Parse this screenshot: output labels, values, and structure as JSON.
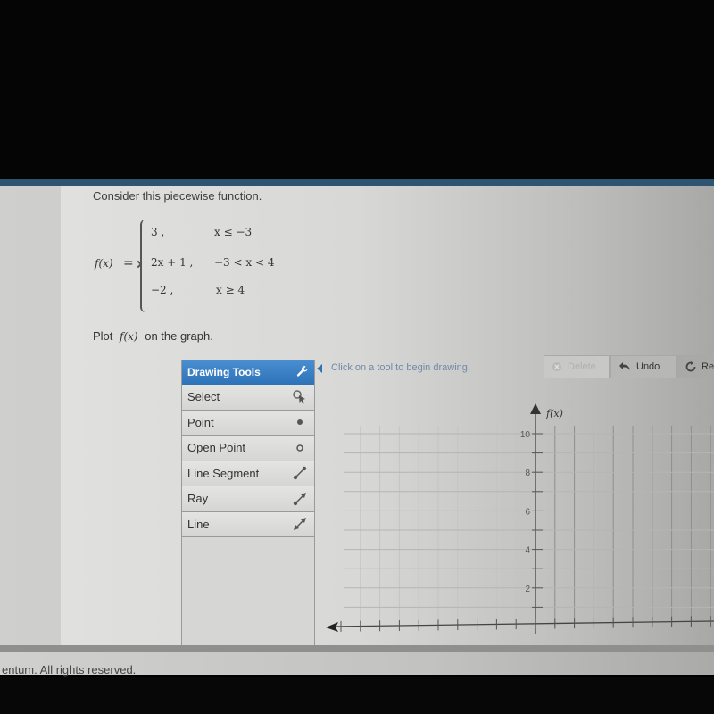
{
  "question": {
    "intro": "Consider this piecewise function.",
    "function_name": "f(x)",
    "equals": "=",
    "pieces": [
      {
        "expression": "3 ,",
        "condition": "x ≤ −3"
      },
      {
        "expression": "2x + 1 ,",
        "condition": "−3 < x < 4"
      },
      {
        "expression": "−2 ,",
        "condition": "x ≥ 4"
      }
    ],
    "instruction_prefix": "Plot",
    "instruction_fx": "f(x)",
    "instruction_suffix": "on the graph."
  },
  "tools_panel": {
    "header": "Drawing Tools",
    "header_icon": "wrench-icon",
    "items": [
      {
        "label": "Select",
        "icon": "select-cursor-icon"
      },
      {
        "label": "Point",
        "icon": "filled-point-icon"
      },
      {
        "label": "Open Point",
        "icon": "open-point-icon"
      },
      {
        "label": "Line Segment",
        "icon": "line-segment-icon"
      },
      {
        "label": "Ray",
        "icon": "ray-icon"
      },
      {
        "label": "Line",
        "icon": "line-icon"
      }
    ]
  },
  "toolbar": {
    "hint": "Click on a tool to begin drawing.",
    "delete_label": "Delete",
    "undo_label": "Undo",
    "reset_label": "Re"
  },
  "graph": {
    "y_axis_label": "f(x)",
    "y_tick_labels": [
      "10",
      "8",
      "6",
      "4",
      "2"
    ],
    "y_range_visible": [
      0,
      10
    ],
    "grid_step": 1
  },
  "footer": {
    "copyright": "entum. All rights reserved."
  }
}
